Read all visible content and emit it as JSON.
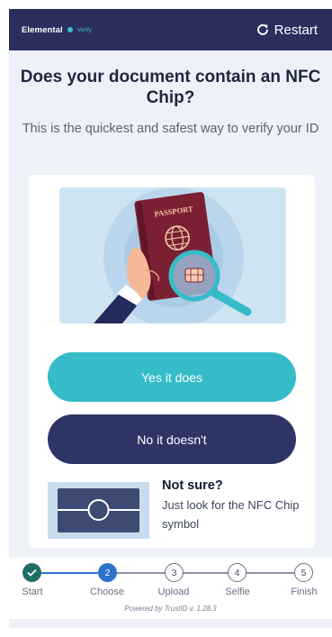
{
  "header": {
    "brand": "Elemental",
    "brand_sub": "Verify",
    "restart_label": "Restart"
  },
  "main": {
    "title": "Does your document contain an NFC Chip?",
    "subtitle": "This is the quickest and safest way to verify your ID"
  },
  "illustration": {
    "passport_text": "PASSPORT"
  },
  "buttons": {
    "yes_label": "Yes it does",
    "no_label": "No it doesn't"
  },
  "hint": {
    "title": "Not sure?",
    "text": "Just look for the NFC Chip symbol"
  },
  "stepper": {
    "current_step": 2,
    "steps": [
      {
        "number": "✓",
        "label": "Start",
        "status": "complete"
      },
      {
        "number": "2",
        "label": "Choose",
        "status": "active"
      },
      {
        "number": "3",
        "label": "Upload",
        "status": "pending"
      },
      {
        "number": "4",
        "label": "Selfie",
        "status": "pending"
      },
      {
        "number": "5",
        "label": "Finish",
        "status": "pending"
      }
    ],
    "powered_by": "Powered by TrustID v. 1.28.3"
  },
  "colors": {
    "header_bg": "#2b2f5e",
    "accent_teal": "#35bcc8",
    "primary_navy": "#2f3466",
    "step_complete": "#1f6e63",
    "step_active": "#2a73c9"
  }
}
